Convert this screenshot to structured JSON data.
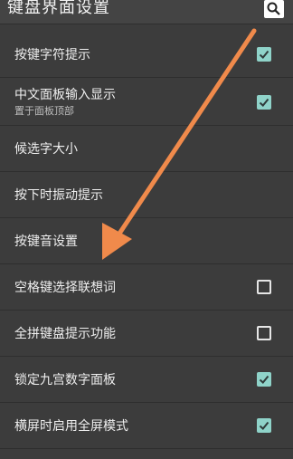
{
  "header": {
    "title": "键盘界面设置",
    "search_icon": "search-icon"
  },
  "settings": [
    {
      "label": "按键字符提示",
      "sub": "",
      "checkbox": true,
      "checked": true
    },
    {
      "label": "中文面板输入显示",
      "sub": "置于面板顶部",
      "checkbox": true,
      "checked": true
    },
    {
      "label": "候选字大小",
      "sub": "",
      "checkbox": false,
      "checked": false
    },
    {
      "label": "按下时振动提示",
      "sub": "",
      "checkbox": false,
      "checked": false
    },
    {
      "label": "按键音设置",
      "sub": "",
      "checkbox": false,
      "checked": false
    },
    {
      "label": "空格键选择联想词",
      "sub": "",
      "checkbox": true,
      "checked": false
    },
    {
      "label": "全拼键盘提示功能",
      "sub": "",
      "checkbox": true,
      "checked": false
    },
    {
      "label": "锁定九宫数字面板",
      "sub": "",
      "checkbox": true,
      "checked": true
    },
    {
      "label": "横屏时启用全屏模式",
      "sub": "",
      "checkbox": true,
      "checked": true
    }
  ],
  "colors": {
    "background": "#3c3c3c",
    "checkbox_on": "#8fd3c9",
    "arrow": "#f08a4b"
  },
  "annotation": {
    "arrow_icon": "pointer-arrow-icon"
  }
}
